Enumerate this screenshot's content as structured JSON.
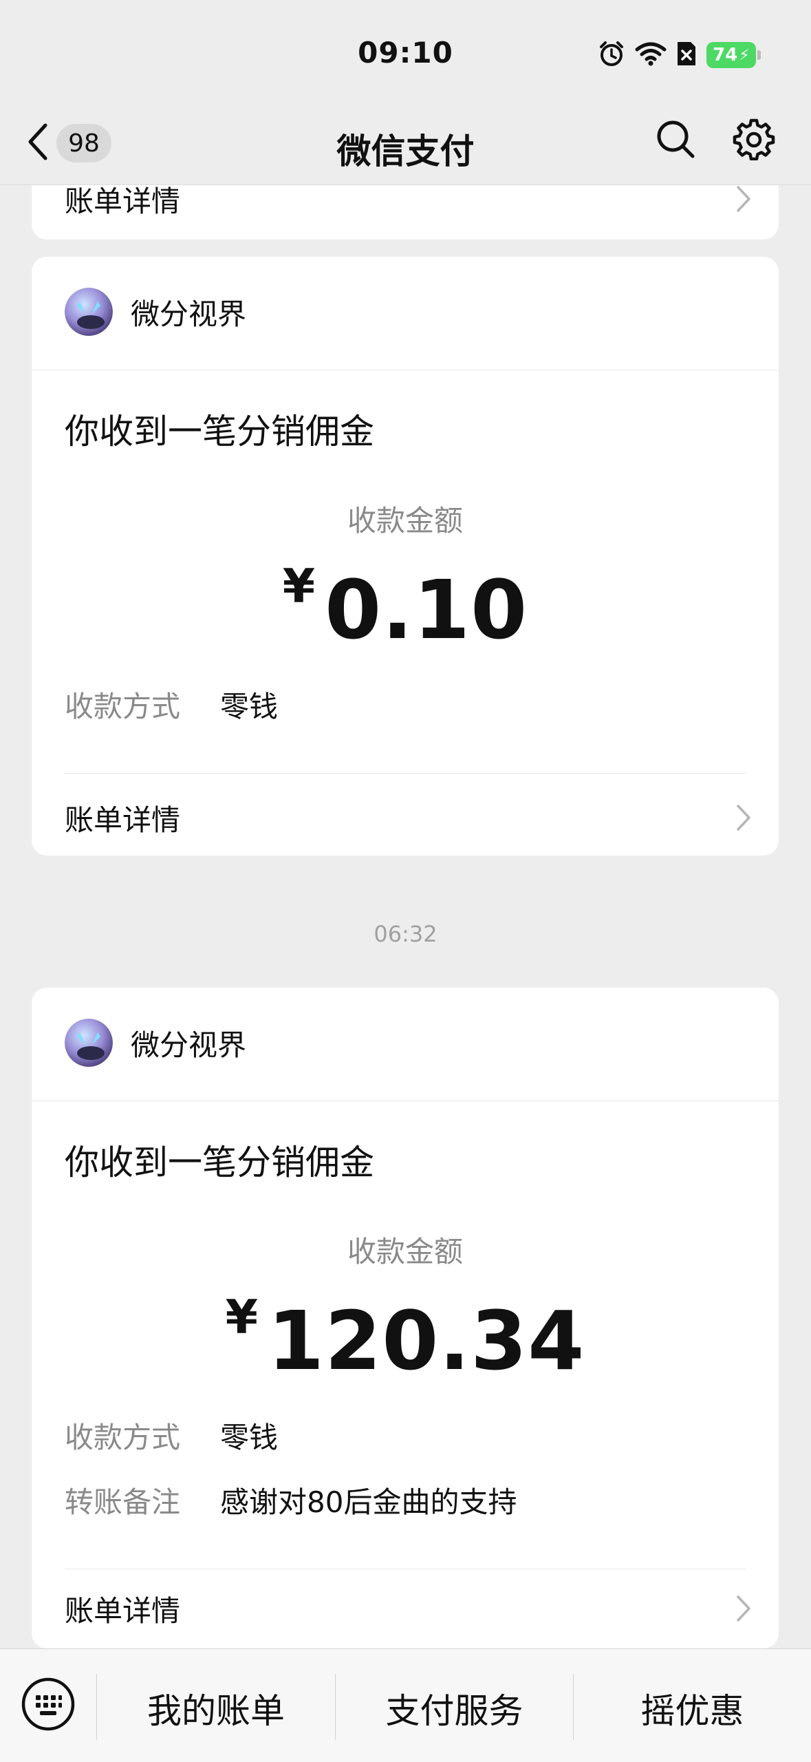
{
  "status_bar": {
    "time": "09:10",
    "battery": "74"
  },
  "nav": {
    "back_count": "98",
    "title": "微信支付"
  },
  "partial_card": {
    "detail_label": "账单详情"
  },
  "cards": [
    {
      "merchant": "微分视界",
      "title": "你收到一笔分销佣金",
      "amount_label": "收款金额",
      "currency": "¥",
      "amount": "0.10",
      "info": [
        {
          "key": "收款方式",
          "value": "零钱"
        }
      ],
      "detail_label": "账单详情"
    },
    {
      "merchant": "微分视界",
      "title": "你收到一笔分销佣金",
      "amount_label": "收款金额",
      "currency": "¥",
      "amount": "120.34",
      "info": [
        {
          "key": "收款方式",
          "value": "零钱"
        },
        {
          "key": "转账备注",
          "value": "感谢对80后金曲的支持"
        }
      ],
      "detail_label": "账单详情"
    }
  ],
  "timestamp": "06:32",
  "bottom_menu": [
    "我的账单",
    "支付服务",
    "摇优惠"
  ],
  "colors": {
    "background": "#ededed",
    "card": "#ffffff",
    "battery": "#4cd964",
    "muted_text": "#8a8a8a"
  }
}
